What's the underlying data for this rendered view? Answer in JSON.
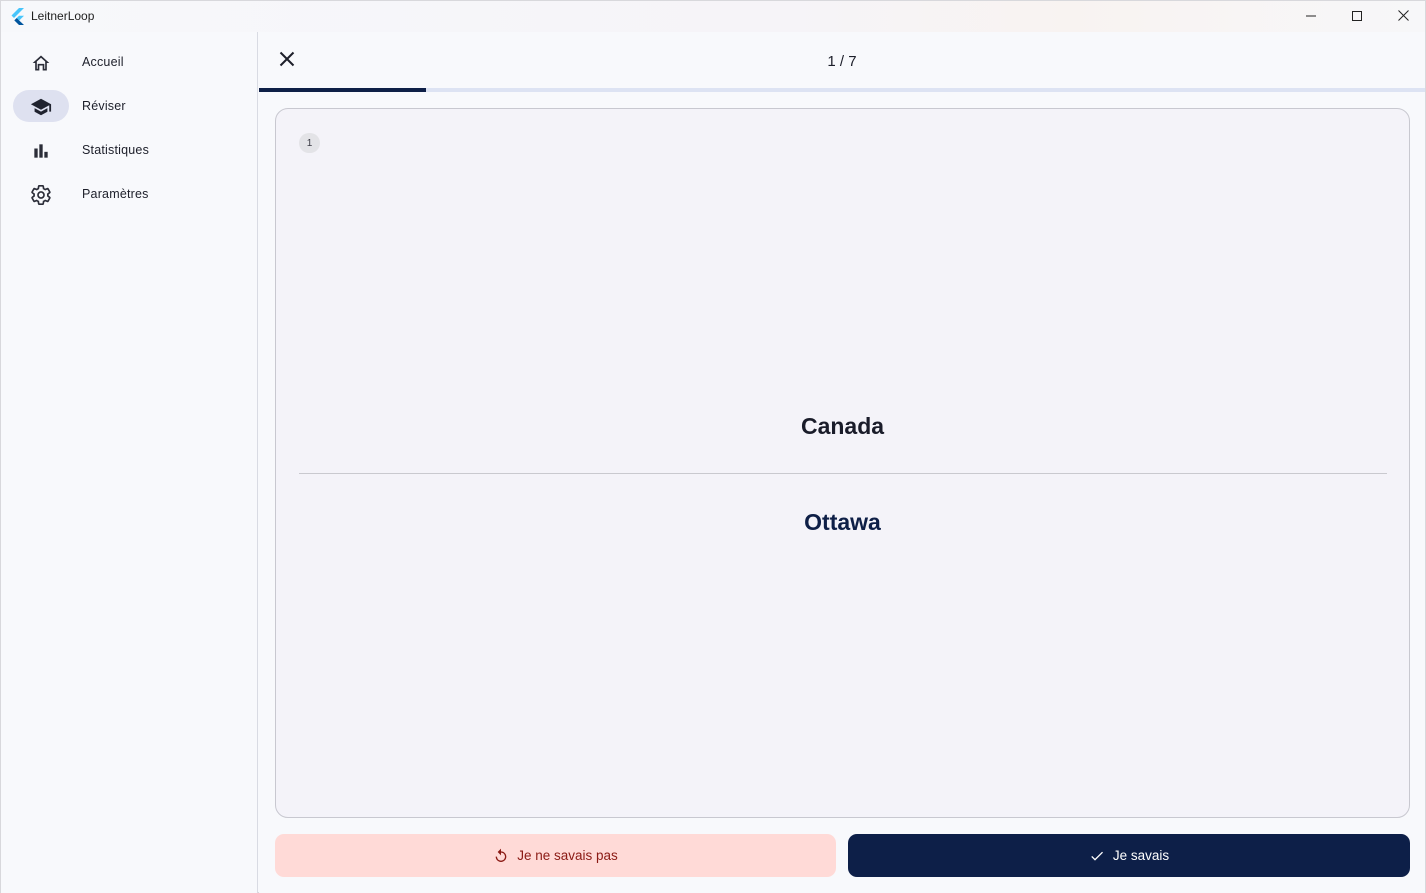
{
  "window": {
    "title": "LeitnerLoop",
    "icons": {
      "logo": "flutter-logo-icon",
      "minimize": "minimize-icon",
      "maximize": "maximize-icon",
      "close": "close-icon"
    }
  },
  "sidebar": {
    "items": [
      {
        "label": "Accueil",
        "icon": "home-icon",
        "active": false
      },
      {
        "label": "Réviser",
        "icon": "school-icon",
        "active": true
      },
      {
        "label": "Statistiques",
        "icon": "bar-chart-icon",
        "active": false
      },
      {
        "label": "Paramètres",
        "icon": "gear-icon",
        "active": false
      }
    ]
  },
  "review": {
    "counter": "1 / 7",
    "progress": 0.143,
    "close_icon": "close-icon",
    "card": {
      "box_number": "1",
      "question": "Canada",
      "answer": "Ottawa"
    },
    "buttons": {
      "wrong_label": "Je ne savais pas",
      "wrong_icon": "refresh-icon",
      "right_label": "Je savais",
      "right_icon": "check-icon"
    }
  },
  "colors": {
    "primary": "#0d1f48",
    "error_container": "#ffdad7",
    "on_error_container": "#8b1a14",
    "nav_active": "#dee1f0",
    "card_bg": "#f4f3f9"
  }
}
